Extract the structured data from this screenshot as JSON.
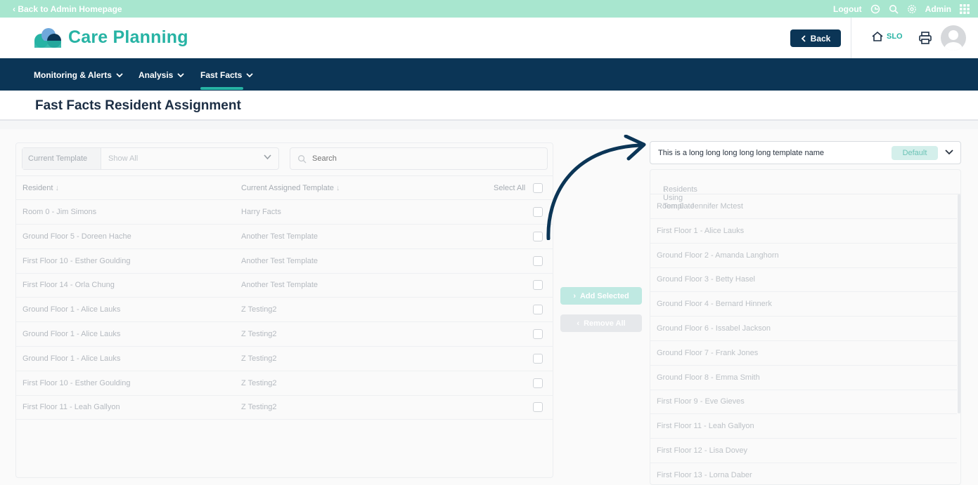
{
  "topbar": {
    "back_label": "‹ Back to Admin Homepage",
    "logout_label": "Logout",
    "admin_label": "Admin"
  },
  "header": {
    "app_title": "Care Planning",
    "back_button": "Back",
    "home_label": "SLO"
  },
  "nav": {
    "items": [
      "Monitoring & Alerts",
      "Analysis",
      "Fast Facts"
    ],
    "active": "Fast Facts"
  },
  "page": {
    "title": "Fast Facts Resident Assignment"
  },
  "left": {
    "filter_label": "Current Template",
    "filter_value": "Show All",
    "search_placeholder": "Search",
    "col_resident": "Resident",
    "col_template": "Current Assigned Template",
    "select_all": "Select All",
    "rows": [
      {
        "resident": "Room 0 - Jim Simons",
        "template": "Harry Facts"
      },
      {
        "resident": "Ground Floor 5 - Doreen Hache",
        "template": "Another Test Template"
      },
      {
        "resident": "First Floor 10 - Esther Goulding",
        "template": "Another Test Template"
      },
      {
        "resident": "First Floor 14 - Orla Chung",
        "template": "Another Test Template"
      },
      {
        "resident": "Ground Floor 1 - Alice Lauks",
        "template": "Z Testing2"
      },
      {
        "resident": "Ground Floor 1 - Alice Lauks",
        "template": "Z Testing2"
      },
      {
        "resident": "Ground Floor 1 - Alice Lauks",
        "template": "Z Testing2"
      },
      {
        "resident": "First Floor 10 - Esther Goulding",
        "template": "Z Testing2"
      },
      {
        "resident": "First Floor 11 - Leah Gallyon",
        "template": "Z Testing2"
      }
    ]
  },
  "middle": {
    "add_selected": "Add Selected",
    "remove_all": "Remove All"
  },
  "right": {
    "template_name": "This is a long long long long long template name",
    "badge": "Default",
    "col_residents": "Residents Using Template",
    "rows": [
      "Room 0 - Jennifer Mctest",
      "First Floor 1 - Alice Lauks",
      "Ground Floor 2 - Amanda Langhorn",
      "Ground Floor 3 - Betty Hasel",
      "Ground Floor 4 - Bernard Hinnerk",
      "Ground Floor 6 - Issabel Jackson",
      "Ground Floor 7 - Frank Jones",
      "Ground Floor 8 - Emma Smith",
      "First Floor 9 - Eve Gieves",
      "First Floor 11 - Leah Gallyon",
      "First Floor 12 - Lisa Dovey",
      "First Floor 13 - Lorna Daber"
    ]
  },
  "colors": {
    "topbar": "#a8e6cf",
    "navy": "#0b3556",
    "teal": "#27b3a4"
  }
}
